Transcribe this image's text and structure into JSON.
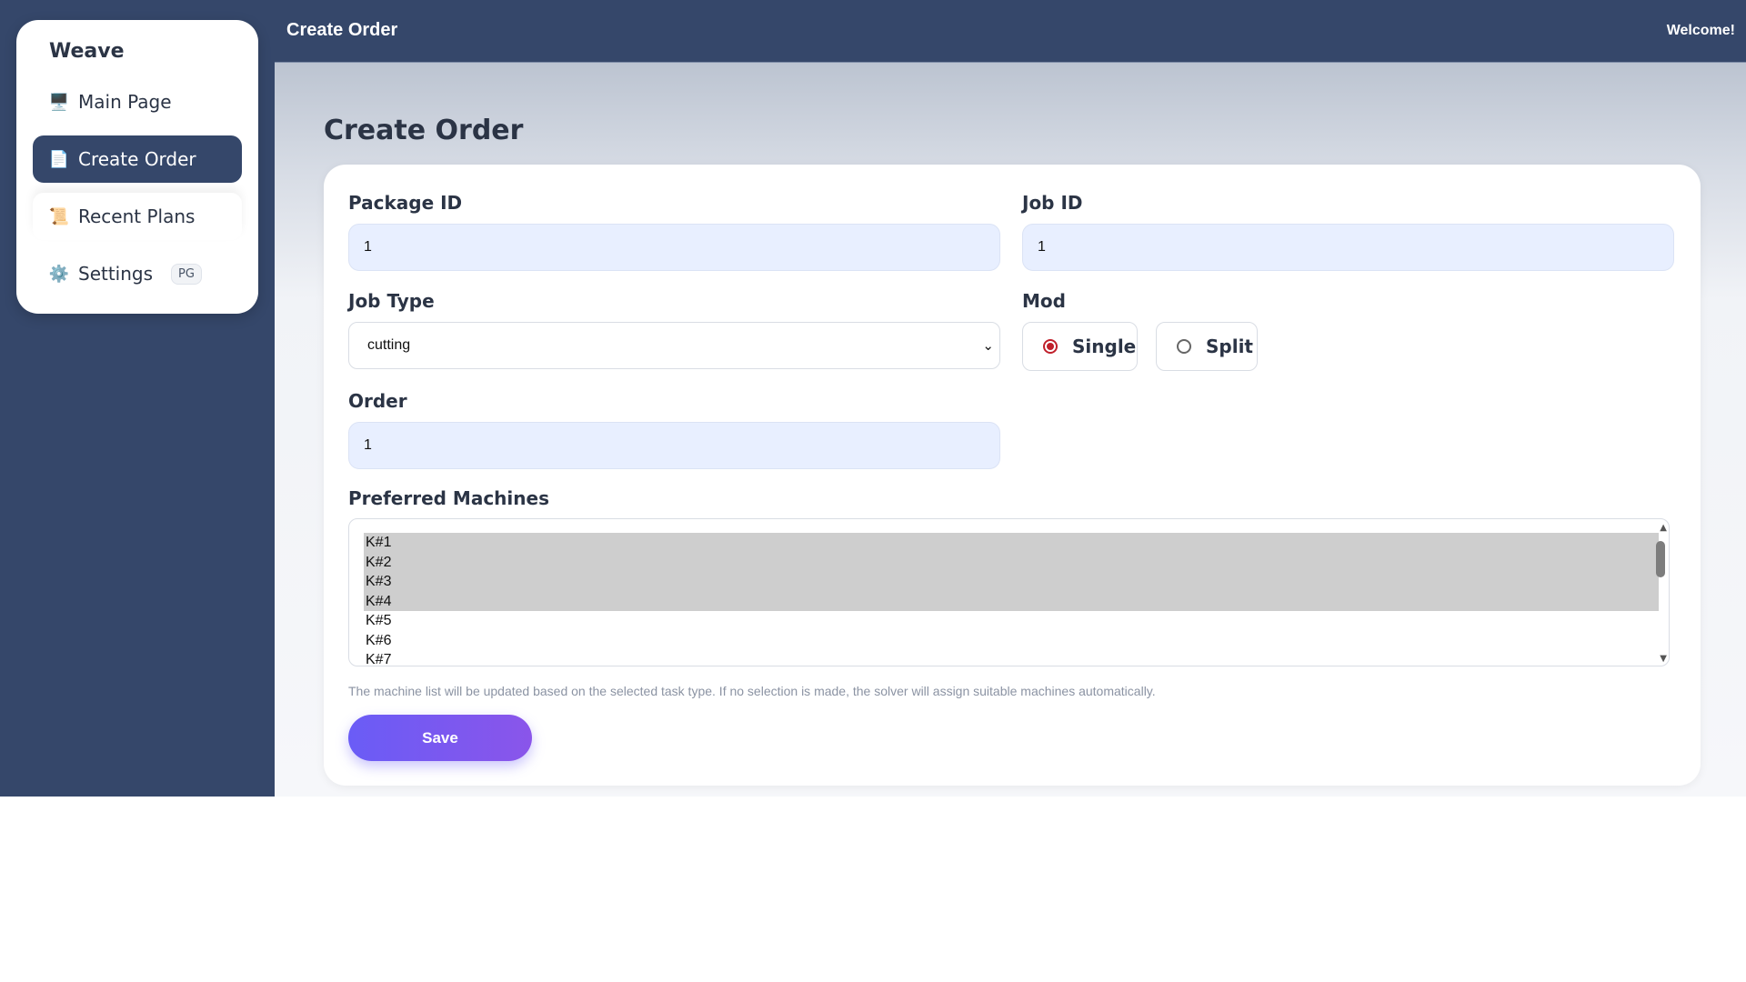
{
  "app": {
    "brand": "Weave"
  },
  "sidebar": {
    "items": [
      {
        "label": "Main Page",
        "icon": "monitor-icon",
        "glyph": "🖥️"
      },
      {
        "label": "Create Order",
        "icon": "document-icon",
        "glyph": "📄"
      },
      {
        "label": "Recent Plans",
        "icon": "scroll-icon",
        "glyph": "📜"
      },
      {
        "label": "Settings",
        "icon": "gear-icon",
        "glyph": "⚙️",
        "badge": "PG"
      }
    ],
    "active": "Create Order"
  },
  "topbar": {
    "title": "Create Order",
    "welcome": "Welcome!"
  },
  "page": {
    "title": "Create Order"
  },
  "form": {
    "package_id": {
      "label": "Package ID",
      "value": "1"
    },
    "job_id": {
      "label": "Job ID",
      "value": "1"
    },
    "job_type": {
      "label": "Job Type",
      "value": "cutting"
    },
    "mod": {
      "label": "Mod",
      "options": [
        "Single",
        "Split"
      ],
      "selected": "Single"
    },
    "order": {
      "label": "Order",
      "value": "1"
    },
    "preferred_machines": {
      "label": "Preferred Machines",
      "options": [
        "K#1",
        "K#2",
        "K#3",
        "K#4",
        "K#5",
        "K#6",
        "K#7"
      ],
      "selected": [
        "K#1",
        "K#2",
        "K#3",
        "K#4"
      ]
    },
    "help_text": "The machine list will be updated based on the selected task type. If no selection is made, the solver will assign suitable machines automatically.",
    "save_label": "Save"
  },
  "colors": {
    "sidebar_bg": "#35476a",
    "accent_gradient_start": "#6a5cf6",
    "accent_gradient_end": "#8a55ea",
    "input_bg": "#e8efff",
    "radio_checked": "#c0202b"
  }
}
